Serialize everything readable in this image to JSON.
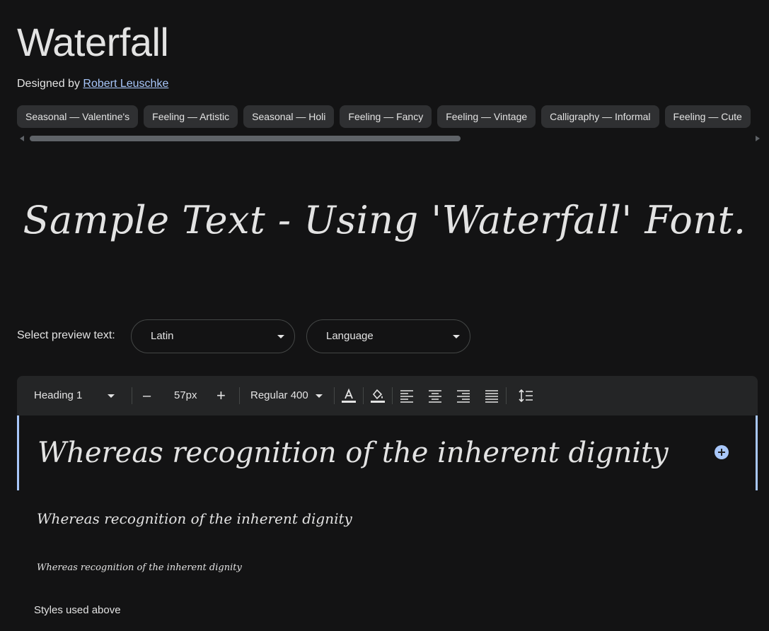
{
  "page": {
    "title": "Waterfall",
    "designed_by_prefix": "Designed by ",
    "designer_name": "Robert Leuschke"
  },
  "tags": [
    "Seasonal — Valentine's",
    "Feeling — Artistic",
    "Seasonal — Holi",
    "Feeling — Fancy",
    "Feeling — Vintage",
    "Calligraphy — Informal",
    "Feeling — Cute"
  ],
  "sample_text": "Sample Text - Using 'Waterfall' Font.",
  "preview": {
    "label": "Select preview text:",
    "script_value": "Latin",
    "language_value": "Language"
  },
  "toolbar": {
    "style_value": "Heading 1",
    "size_value": "57px",
    "minus_glyph": "–",
    "plus_glyph": "+",
    "weight_value": "Regular 400"
  },
  "preview_rows": [
    "Whereas recognition of the inherent dignity",
    "Whereas recognition of the inherent dignity",
    "Whereas recognition of the inherent dignity"
  ],
  "styles_used_label": "Styles used above",
  "colors": {
    "background": "#131314",
    "chip": "#2f3032",
    "toolbar": "#242526",
    "accent": "#a8c7fa"
  }
}
